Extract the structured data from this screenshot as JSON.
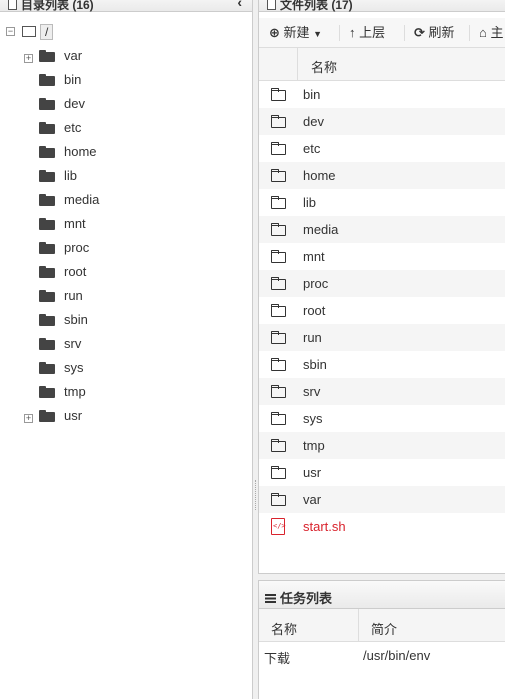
{
  "left_panel": {
    "title": "目录列表 (16)",
    "collapse_icon": "chevron-left-icon",
    "root": {
      "toggle": "−",
      "label": "/"
    },
    "items": [
      {
        "label": "var",
        "expandable": true
      },
      {
        "label": "bin",
        "expandable": false
      },
      {
        "label": "dev",
        "expandable": false
      },
      {
        "label": "etc",
        "expandable": false
      },
      {
        "label": "home",
        "expandable": false
      },
      {
        "label": "lib",
        "expandable": false
      },
      {
        "label": "media",
        "expandable": false
      },
      {
        "label": "mnt",
        "expandable": false
      },
      {
        "label": "proc",
        "expandable": false
      },
      {
        "label": "root",
        "expandable": false
      },
      {
        "label": "run",
        "expandable": false
      },
      {
        "label": "sbin",
        "expandable": false
      },
      {
        "label": "srv",
        "expandable": false
      },
      {
        "label": "sys",
        "expandable": false
      },
      {
        "label": "tmp",
        "expandable": false
      },
      {
        "label": "usr",
        "expandable": true
      }
    ]
  },
  "file_panel": {
    "title": "文件列表 (17)",
    "toolbar": {
      "new_label": "新建",
      "up_label": "上层",
      "refresh_label": "刷新",
      "home_label": "主"
    },
    "column_name": "名称",
    "files": [
      {
        "name": "bin",
        "type": "folder"
      },
      {
        "name": "dev",
        "type": "folder"
      },
      {
        "name": "etc",
        "type": "folder"
      },
      {
        "name": "home",
        "type": "folder"
      },
      {
        "name": "lib",
        "type": "folder"
      },
      {
        "name": "media",
        "type": "folder"
      },
      {
        "name": "mnt",
        "type": "folder"
      },
      {
        "name": "proc",
        "type": "folder"
      },
      {
        "name": "root",
        "type": "folder"
      },
      {
        "name": "run",
        "type": "folder"
      },
      {
        "name": "sbin",
        "type": "folder"
      },
      {
        "name": "srv",
        "type": "folder"
      },
      {
        "name": "sys",
        "type": "folder"
      },
      {
        "name": "tmp",
        "type": "folder"
      },
      {
        "name": "usr",
        "type": "folder"
      },
      {
        "name": "var",
        "type": "folder"
      },
      {
        "name": "start.sh",
        "type": "script",
        "color": "#d9232d"
      }
    ]
  },
  "task_panel": {
    "title": "任务列表",
    "col_name": "名称",
    "col_desc": "简介",
    "rows": [
      {
        "name": "下载",
        "desc": "/usr/bin/env"
      }
    ]
  }
}
